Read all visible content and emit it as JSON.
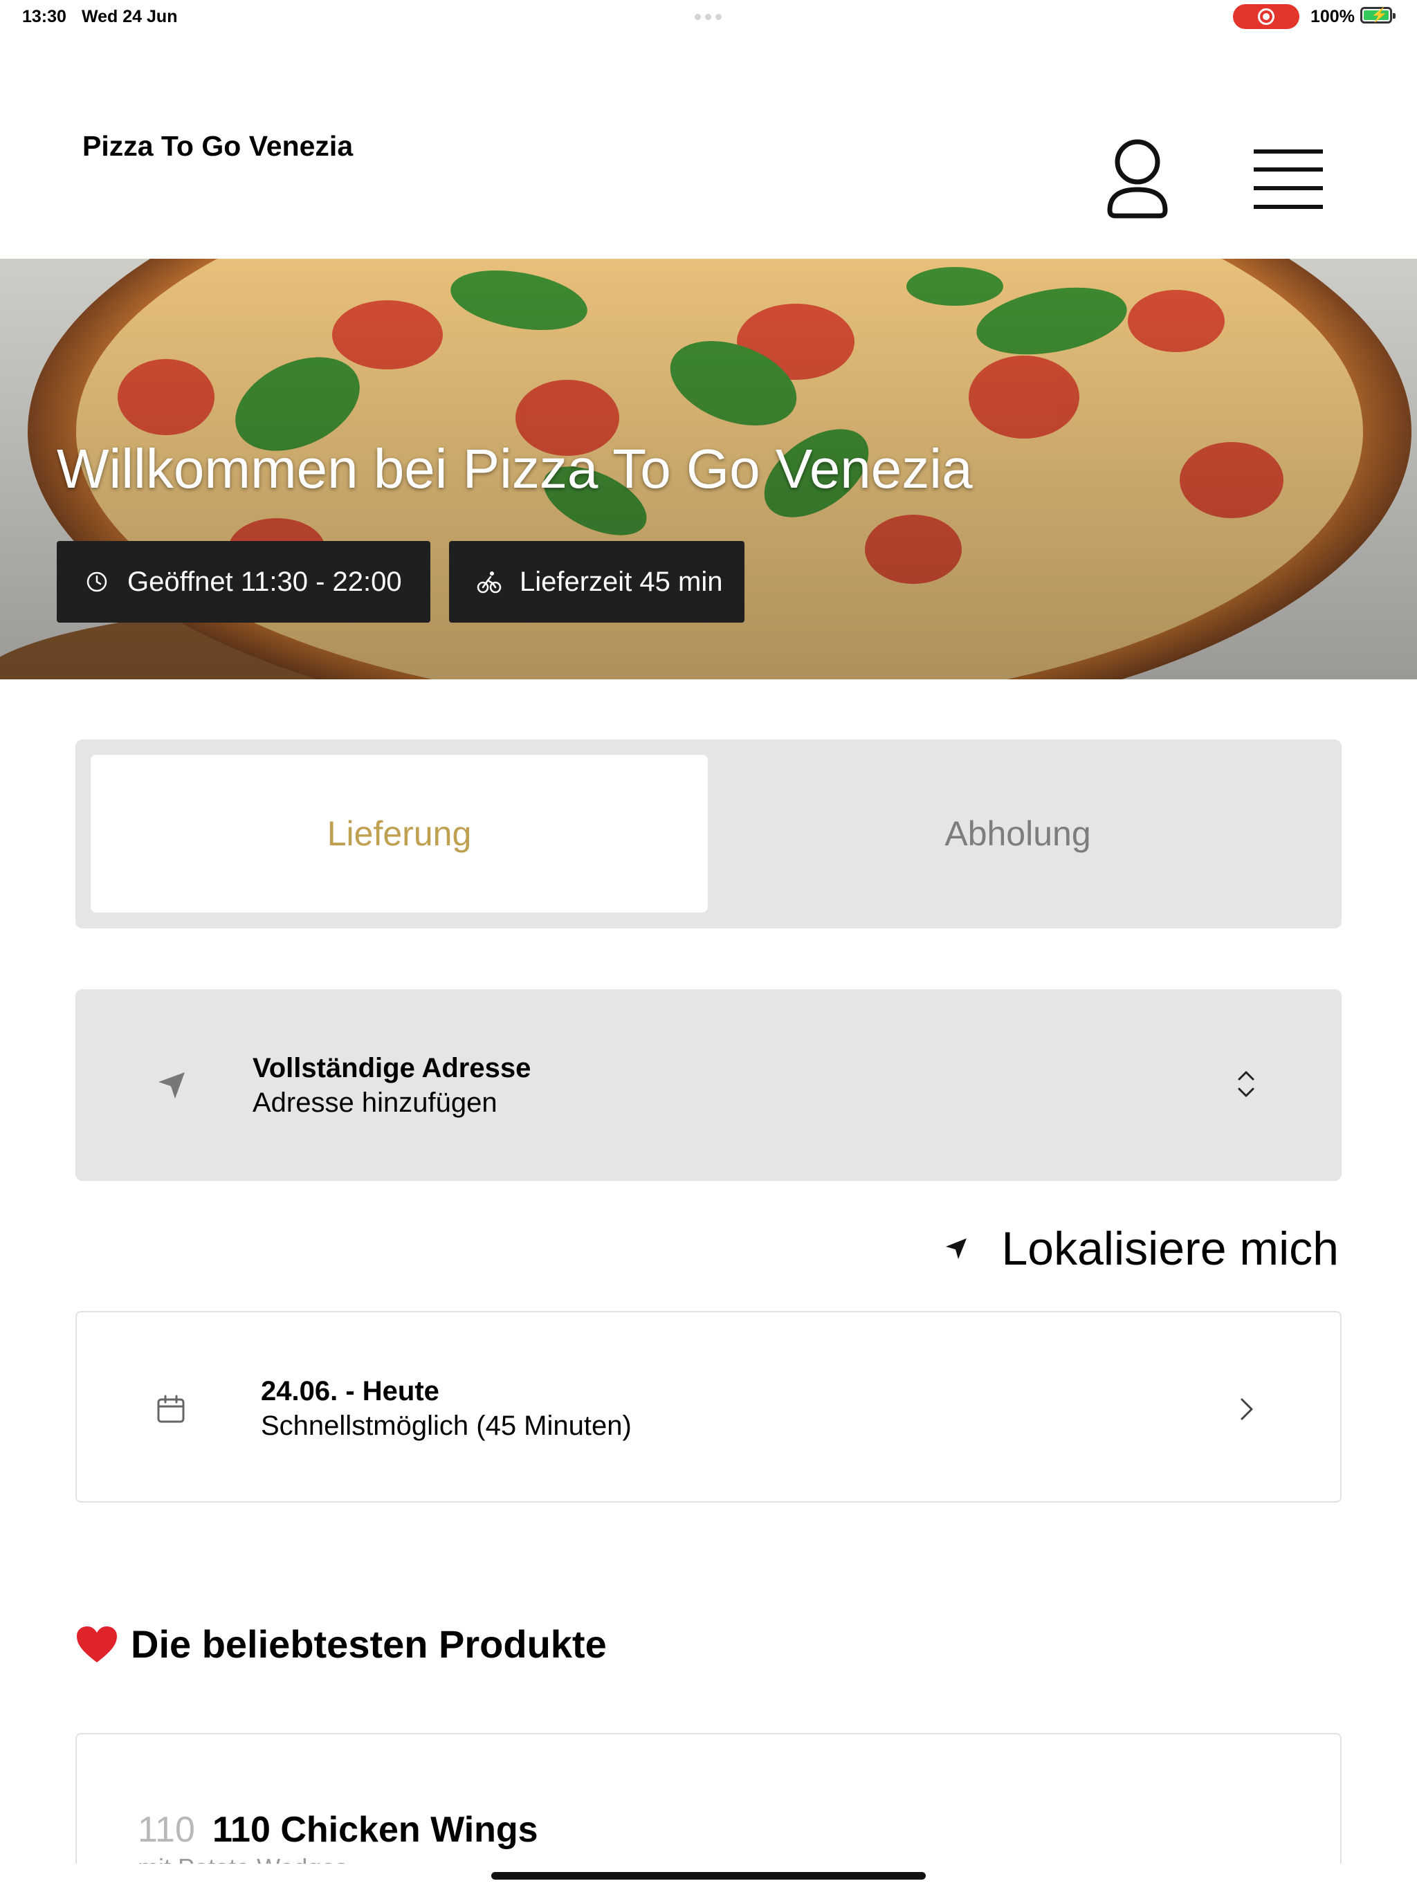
{
  "status_bar": {
    "time": "13:30",
    "date": "Wed 24 Jun",
    "battery": "100%"
  },
  "header": {
    "brand": "Pizza To Go Venezia",
    "icons": [
      "user-icon",
      "menu-icon"
    ]
  },
  "hero": {
    "title": "Willkommen bei Pizza To Go Venezia",
    "open_hours": "Geöffnet 11:30 - 22:00",
    "delivery_time": "Lieferzeit 45 min"
  },
  "order_mode": {
    "options": [
      "Lieferung",
      "Abholung"
    ],
    "selected": "Lieferung"
  },
  "address": {
    "title": "Vollständige Adresse",
    "subtitle": "Adresse hinzufügen"
  },
  "locate": {
    "label": "Lokalisiere mich"
  },
  "schedule": {
    "title": "24.06. - Heute",
    "subtitle": "Schnellstmöglich (45 Minuten)"
  },
  "popular": {
    "title": "Die beliebtesten Produkte",
    "items": [
      {
        "number": "110",
        "name": "110 Chicken Wings",
        "description": "mit Potato Wedges"
      }
    ]
  },
  "colors": {
    "accent": "#bfa050",
    "dark_badge": "#1f1f1f",
    "panel": "#e5e5e5"
  }
}
